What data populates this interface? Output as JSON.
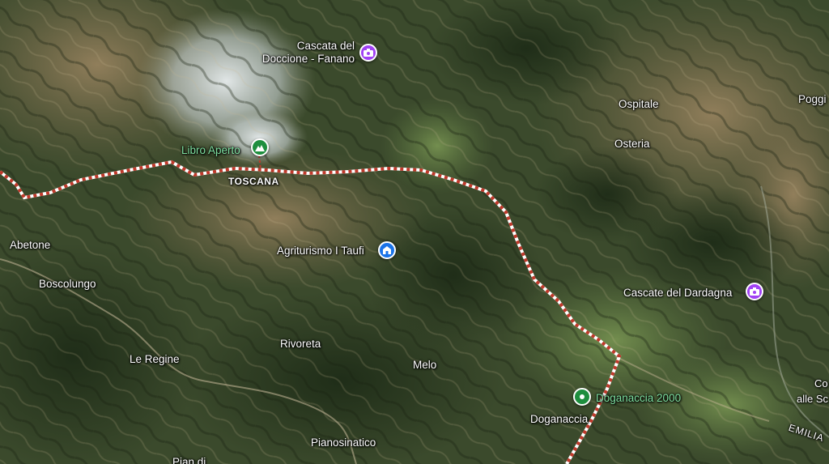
{
  "map": {
    "view": "satellite",
    "region_label": "TOSCANA",
    "edge_label": "EMILIA",
    "places": [
      {
        "name": "Abetone"
      },
      {
        "name": "Boscolungo"
      },
      {
        "name": "Le Regine"
      },
      {
        "name": "Rivoreta"
      },
      {
        "name": "Melo"
      },
      {
        "name": "Pianosinatico"
      },
      {
        "name": "Doganaccia"
      },
      {
        "name": "Ospitale"
      },
      {
        "name": "Osteria"
      },
      {
        "name": "Poggi"
      },
      {
        "name": "Pian di"
      }
    ],
    "pois": [
      {
        "name_line1": "Cascata del",
        "name_line2": "Doccione - Fanano",
        "icon": "camera-icon",
        "color": "#a142f4"
      },
      {
        "name": "Libro Aperto",
        "icon": "mountain-icon",
        "color": "#1e8e3e"
      },
      {
        "name": "Agriturismo I Taufi",
        "icon": "lodging-icon",
        "color": "#1a73e8"
      },
      {
        "name": "Cascate del Dardagna",
        "icon": "camera-icon",
        "color": "#a142f4"
      },
      {
        "name": "Doganaccia 2000",
        "icon": "place-pin-icon",
        "color": "#1e8e3e"
      }
    ],
    "edge_fragments": [
      "Co",
      "alle Sc"
    ],
    "boundary_color": "#c0392b"
  }
}
